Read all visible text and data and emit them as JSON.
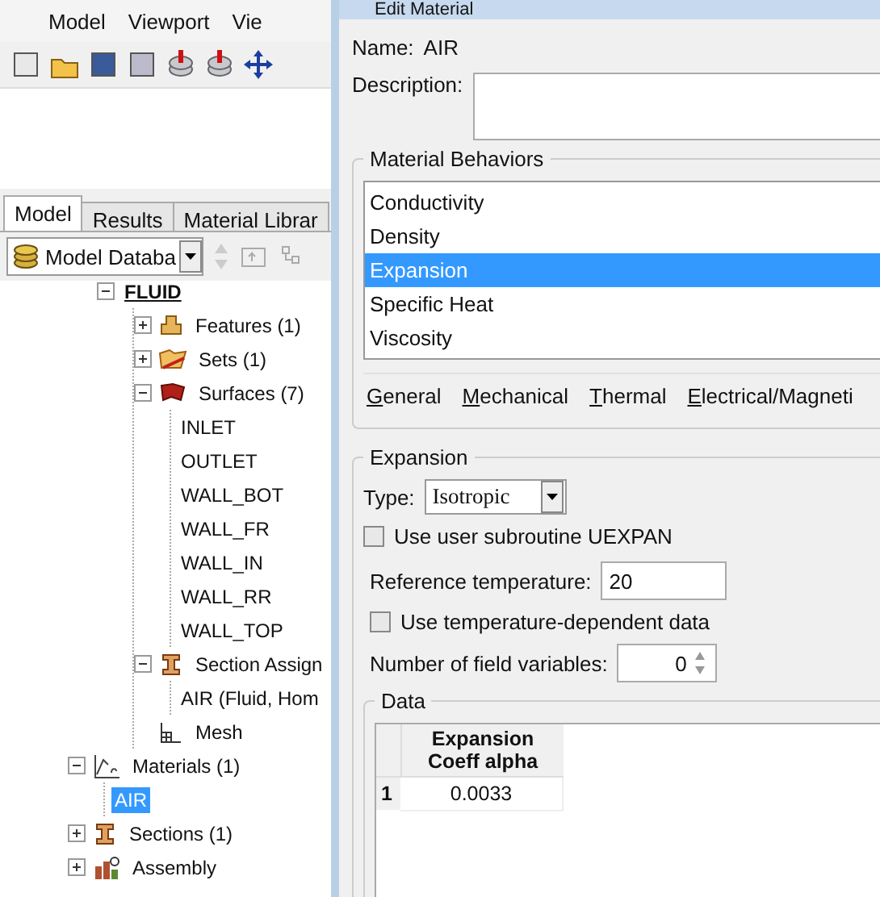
{
  "menu_bar": [
    "Model",
    "Viewport",
    "Vie"
  ],
  "model_tabs": [
    {
      "label": "Model",
      "selected": true
    },
    {
      "label": "Results",
      "selected": false
    },
    {
      "label": "Material Librar",
      "selected": false
    }
  ],
  "database_combo": {
    "value": "Model Databa"
  },
  "tree": {
    "partial_branch": [
      {
        "label": "FLUID",
        "kind": "part",
        "expanded": true,
        "selected": false,
        "children": [
          {
            "label": "Features (1)",
            "kind": "feature",
            "expanded": false,
            "selected": false
          },
          {
            "label": "Sets (1)",
            "kind": "set",
            "expanded": false,
            "selected": false
          },
          {
            "label": "Surfaces (7)",
            "kind": "surface",
            "expanded": true,
            "selected": false,
            "children": [
              {
                "label": "INLET",
                "kind": "leaf",
                "selected": false
              },
              {
                "label": "OUTLET",
                "kind": "leaf",
                "selected": false
              },
              {
                "label": "WALL_BOT",
                "kind": "leaf",
                "selected": false
              },
              {
                "label": "WALL_FR",
                "kind": "leaf",
                "selected": false
              },
              {
                "label": "WALL_IN",
                "kind": "leaf",
                "selected": false
              },
              {
                "label": "WALL_RR",
                "kind": "leaf",
                "selected": false
              },
              {
                "label": "WALL_TOP",
                "kind": "leaf",
                "selected": false
              }
            ]
          },
          {
            "label": "Section Assign",
            "kind": "section",
            "expanded": true,
            "selected": false,
            "children": [
              {
                "label": "AIR (Fluid, Hom",
                "kind": "leaf",
                "selected": false
              }
            ]
          },
          {
            "label": "Mesh",
            "kind": "mesh",
            "selected": false
          }
        ]
      }
    ],
    "items": [
      {
        "label": "Materials (1)",
        "kind": "material",
        "expanded": true,
        "selected": false,
        "children": [
          {
            "label": "AIR",
            "kind": "leaf",
            "selected": true
          }
        ]
      },
      {
        "label": "Sections (1)",
        "kind": "section",
        "expanded": false,
        "selected": false
      },
      {
        "label": "Assembly",
        "kind": "assembly",
        "expanded": false,
        "selected": false
      }
    ]
  },
  "dialog": {
    "title": "Edit Material",
    "name_label": "Name:",
    "name_value": "AIR",
    "description_label": "Description:",
    "behaviors_title": "Material Behaviors",
    "behaviors": [
      {
        "label": "Conductivity",
        "selected": false
      },
      {
        "label": "Density",
        "selected": false
      },
      {
        "label": "Expansion",
        "selected": true
      },
      {
        "label": "Specific Heat",
        "selected": false
      },
      {
        "label": "Viscosity",
        "selected": false
      }
    ],
    "menus": [
      "General",
      "Mechanical",
      "Thermal",
      "Electrical/Magneti"
    ],
    "section_title": "Expansion",
    "type_label": "Type:",
    "type_value": "Isotropic",
    "user_subroutine": {
      "label": "Use user subroutine UEXPAN",
      "checked": false
    },
    "reference_label": "Reference temperature:",
    "reference_value": "20",
    "temp_dependent": {
      "label": "Use temperature-dependent data",
      "checked": false
    },
    "field_vars_label": "Number of field variables:",
    "field_vars_value": "0",
    "data_title": "Data",
    "table": {
      "columns": [
        "Expansion\nCoeff alpha"
      ],
      "rows": [
        {
          "index": "1",
          "cells": [
            "0.0033"
          ]
        }
      ]
    }
  }
}
